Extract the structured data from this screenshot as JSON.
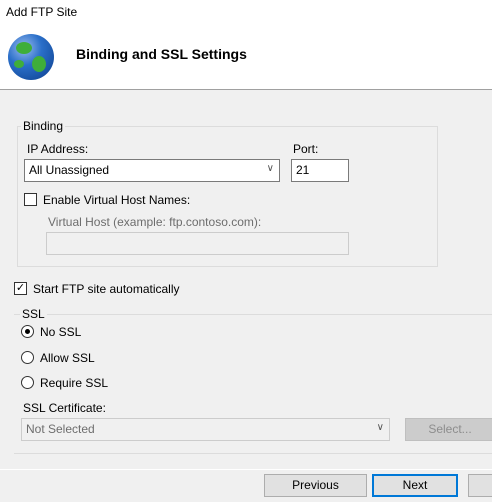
{
  "window": {
    "title": "Add FTP Site"
  },
  "header": {
    "heading": "Binding and SSL Settings",
    "icon": "globe-icon"
  },
  "binding": {
    "group_label": "Binding",
    "ip_label": "IP Address:",
    "ip_value": "All Unassigned",
    "port_label": "Port:",
    "port_value": "21",
    "virtual_host_checkbox": "Enable Virtual Host Names:",
    "virtual_host_checked": false,
    "virtual_host_label": "Virtual Host (example: ftp.contoso.com):",
    "virtual_host_value": ""
  },
  "start_auto": {
    "label": "Start FTP site automatically",
    "checked": true
  },
  "ssl": {
    "group_label": "SSL",
    "options": [
      "No SSL",
      "Allow SSL",
      "Require SSL"
    ],
    "selected": "No SSL",
    "cert_label": "SSL Certificate:",
    "cert_value": "Not Selected",
    "select_button": "Select..."
  },
  "footer": {
    "previous": "Previous",
    "next": "Next"
  }
}
